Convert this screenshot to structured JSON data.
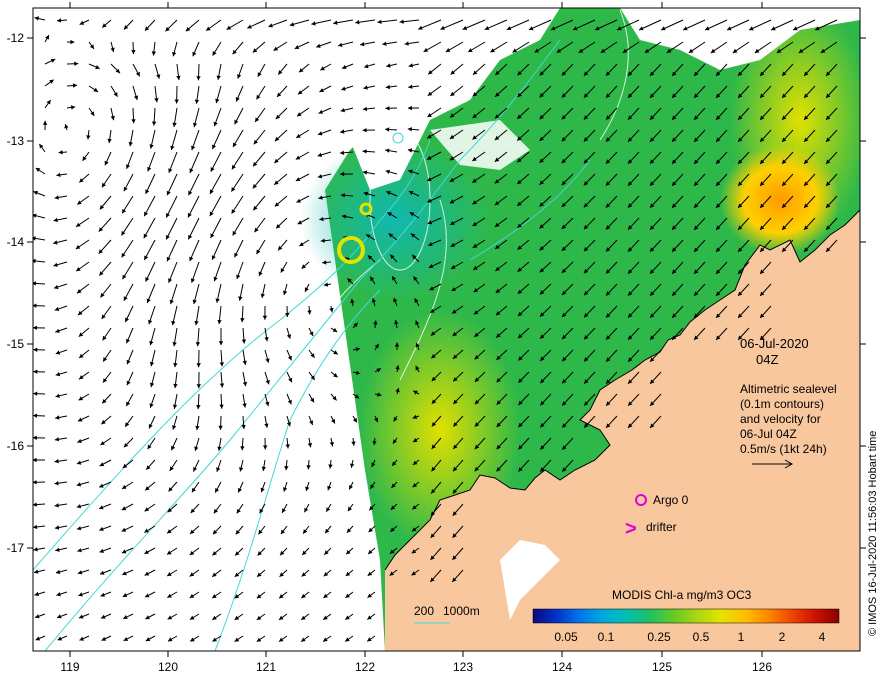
{
  "map": {
    "date": "06-Jul-2020",
    "time": "04Z",
    "description_lines": [
      "Altimetric sealevel",
      "(0.1m contours)",
      "and velocity for",
      "06-Jul 04Z"
    ],
    "speed_scale": "0.5m/s (1kt 24h)",
    "argo_label": "Argo 0",
    "drifter_label": "drifter",
    "drifter_symbol": ">",
    "isobath_labels": [
      "200",
      "1000m"
    ],
    "colorbar": {
      "title": "MODIS Chl-a mg/m3 OC3",
      "ticks": [
        "0.05",
        "0.1",
        "0.25",
        "0.5",
        "1",
        "2",
        "4"
      ],
      "colors": [
        "#0a0a7a",
        "#0033cc",
        "#0077ee",
        "#00aadd",
        "#00c0b0",
        "#22c060",
        "#66cc22",
        "#aad811",
        "#e6e200",
        "#ffc000",
        "#ff8800",
        "#ee4400",
        "#cc1100",
        "#8a0000"
      ]
    },
    "credit": "© IMOS 16-Jul-2020 11:56:03 Hobart time",
    "colors": {
      "land": "#f9c79e",
      "ocean_chl": "#2fb84a",
      "contour": "#40d8d8",
      "argo": "#dd00dd",
      "arrow": "#000000"
    },
    "x_ticks": [
      "119",
      "120",
      "121",
      "122",
      "123",
      "124",
      "125",
      "126"
    ],
    "y_ticks": [
      "-12",
      "-13",
      "-14",
      "-15",
      "-16",
      "-17"
    ]
  }
}
